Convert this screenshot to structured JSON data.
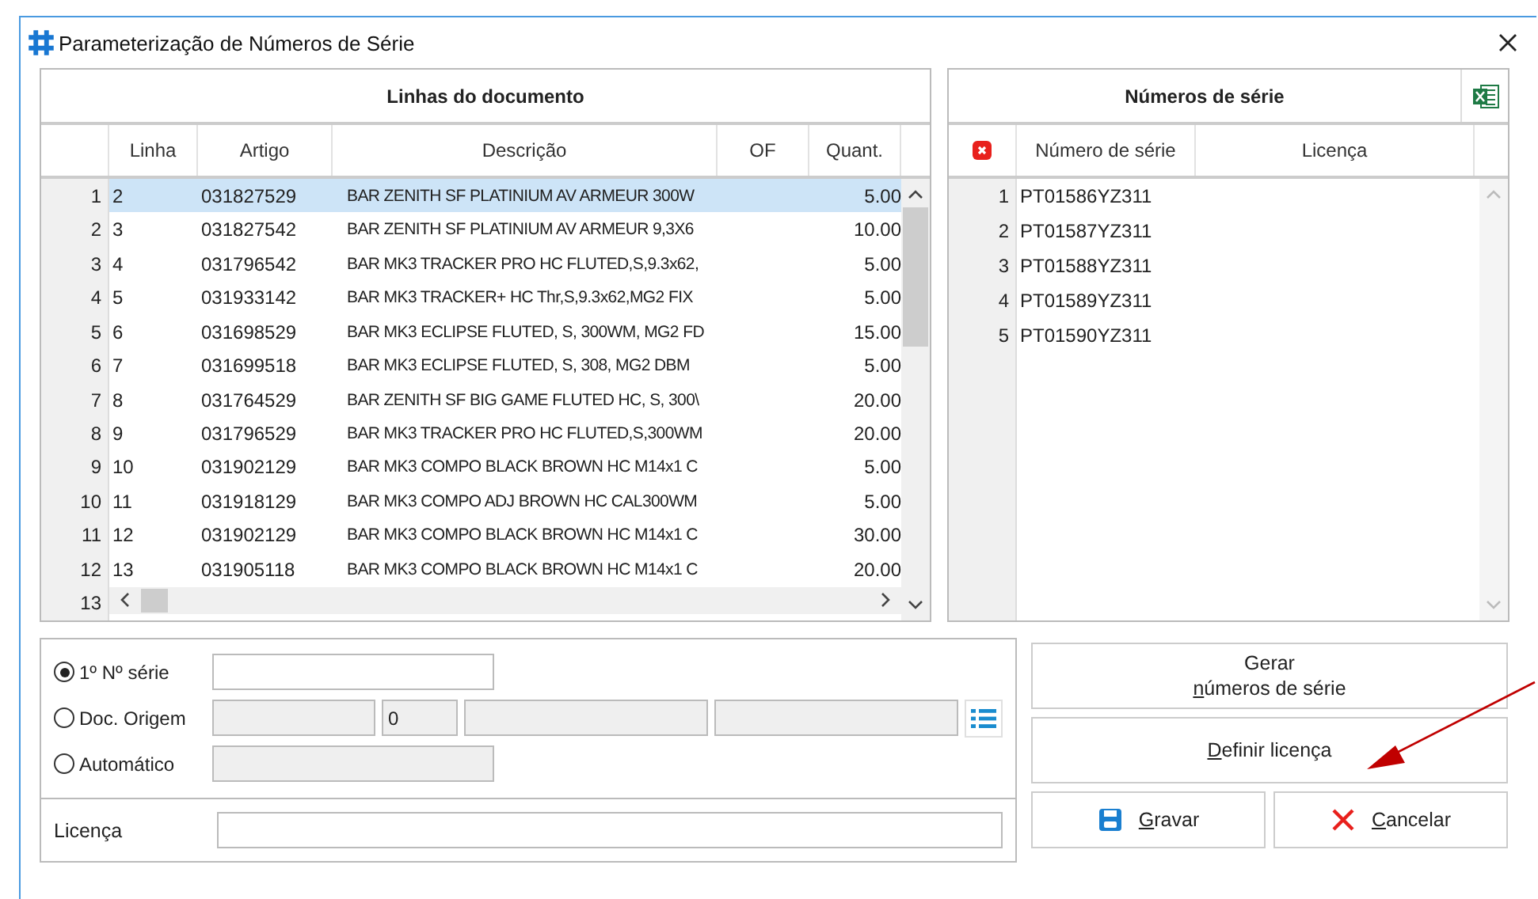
{
  "window": {
    "title": "Parameterização de Números de Série"
  },
  "document_lines": {
    "title": "Linhas do documento",
    "columns": [
      "Linha",
      "Artigo",
      "Descrição",
      "OF",
      "Quant."
    ],
    "rows": [
      {
        "number": "1",
        "linha": "2",
        "artigo": "031827529",
        "descricao": "BAR ZENITH SF PLATINIUM AV ARMEUR 300W",
        "quant": "5.00",
        "selected": true
      },
      {
        "number": "2",
        "linha": "3",
        "artigo": "031827542",
        "descricao": "BAR ZENITH SF PLATINIUM AV ARMEUR 9,3X6",
        "quant": "10.00",
        "selected": false
      },
      {
        "number": "3",
        "linha": "4",
        "artigo": "031796542",
        "descricao": "BAR MK3 TRACKER PRO HC FLUTED,S,9.3x62,",
        "quant": "5.00",
        "selected": false
      },
      {
        "number": "4",
        "linha": "5",
        "artigo": "031933142",
        "descricao": "BAR MK3 TRACKER+ HC Thr,S,9.3x62,MG2 FIX",
        "quant": "5.00",
        "selected": false
      },
      {
        "number": "5",
        "linha": "6",
        "artigo": "031698529",
        "descricao": "BAR MK3 ECLIPSE FLUTED, S, 300WM, MG2 FD",
        "quant": "15.00",
        "selected": false
      },
      {
        "number": "6",
        "linha": "7",
        "artigo": "031699518",
        "descricao": "BAR MK3 ECLIPSE FLUTED, S, 308, MG2 DBM",
        "quant": "5.00",
        "selected": false
      },
      {
        "number": "7",
        "linha": "8",
        "artigo": "031764529",
        "descricao": "BAR ZENITH SF BIG GAME FLUTED HC, S, 300\\",
        "quant": "20.00",
        "selected": false
      },
      {
        "number": "8",
        "linha": "9",
        "artigo": "031796529",
        "descricao": "BAR MK3 TRACKER PRO HC FLUTED,S,300WM",
        "quant": "20.00",
        "selected": false
      },
      {
        "number": "9",
        "linha": "10",
        "artigo": "031902129",
        "descricao": "BAR MK3 COMPO BLACK BROWN HC M14x1 C",
        "quant": "5.00",
        "selected": false
      },
      {
        "number": "10",
        "linha": "11",
        "artigo": "031918129",
        "descricao": "BAR MK3 COMPO ADJ BROWN HC CAL300WM",
        "quant": "5.00",
        "selected": false
      },
      {
        "number": "11",
        "linha": "12",
        "artigo": "031902129",
        "descricao": "BAR MK3 COMPO BLACK BROWN HC M14x1 C",
        "quant": "30.00",
        "selected": false
      },
      {
        "number": "12",
        "linha": "13",
        "artigo": "031905118",
        "descricao": "BAR MK3 COMPO BLACK BROWN HC M14x1 C",
        "quant": "20.00",
        "selected": false
      }
    ],
    "cut_row_number": "13"
  },
  "serial_numbers": {
    "title": "Números de série",
    "columns": [
      "Número de série",
      "Licença"
    ],
    "rows": [
      {
        "number": "1",
        "serial": "PT01586YZ311"
      },
      {
        "number": "2",
        "serial": "PT01587YZ311"
      },
      {
        "number": "3",
        "serial": "PT01588YZ311"
      },
      {
        "number": "4",
        "serial": "PT01589YZ311"
      },
      {
        "number": "5",
        "serial": "PT01590YZ311"
      }
    ]
  },
  "options": [
    {
      "label": "1º Nº série",
      "selected": true,
      "kind": "single"
    },
    {
      "label": "Doc. Origem",
      "selected": false,
      "kind": "doc",
      "number_field": "0"
    },
    {
      "label": "Automático",
      "selected": false,
      "kind": "auto"
    }
  ],
  "license": {
    "label": "Licença"
  },
  "buttons": [
    {
      "kind": "generate",
      "lines": [
        {
          "before": "Gerar"
        },
        {
          "key": "n",
          "after": "úmeros de série"
        }
      ]
    },
    {
      "kind": "license",
      "lines": [
        {
          "key": "D",
          "after": "efinir licença"
        }
      ]
    },
    {
      "kind": "save",
      "lines": [
        {
          "key": "G",
          "after": "ravar"
        }
      ]
    },
    {
      "kind": "cancel",
      "lines": [
        {
          "key": "C",
          "after": "ancelar"
        }
      ]
    }
  ]
}
